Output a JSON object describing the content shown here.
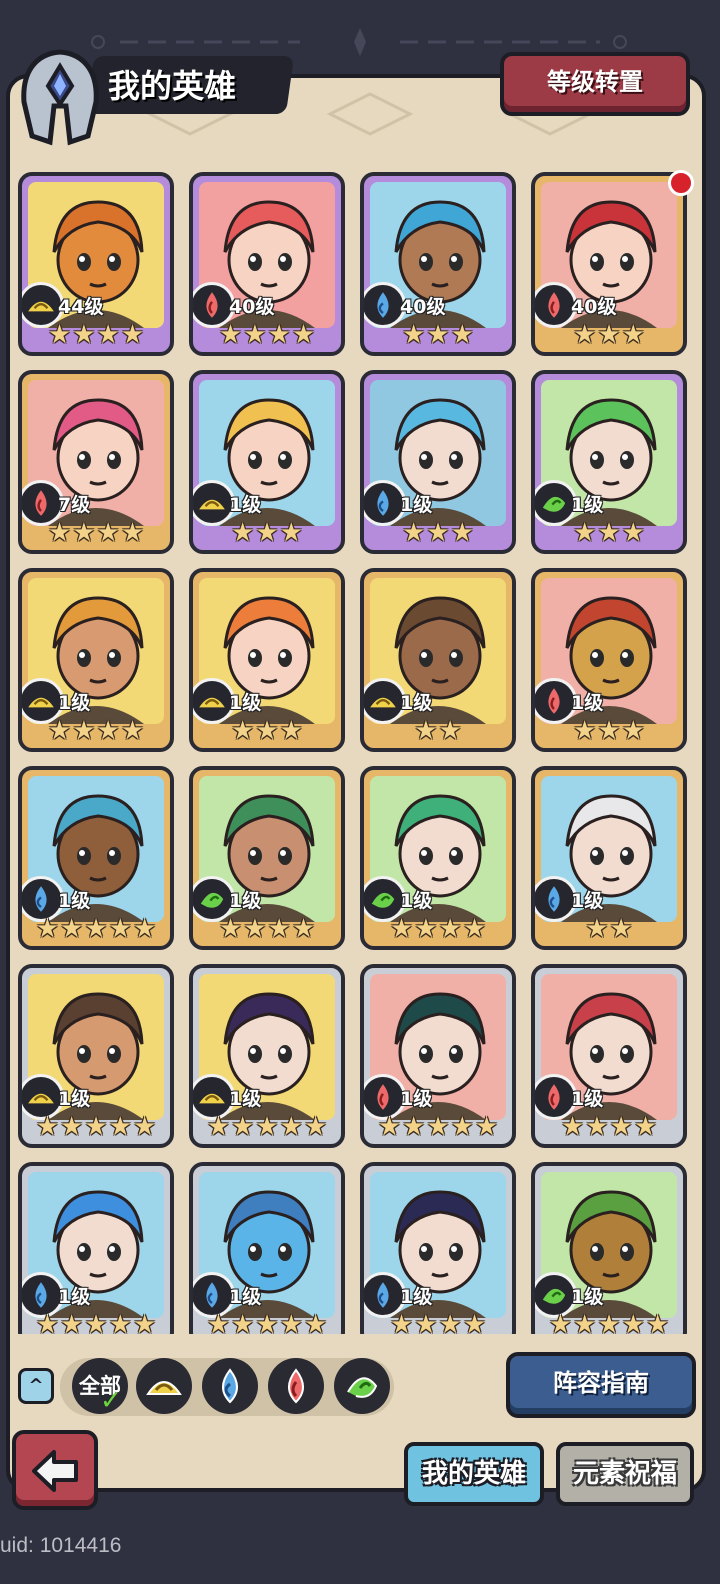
{
  "header": {
    "title": "我的英雄",
    "rank_button": "等级转置"
  },
  "heroes": [
    {
      "level": "44级",
      "stars": 4,
      "element": "earth",
      "frame": "purple",
      "skin": "#e38b3d",
      "hair": "#d9722a",
      "bg": "#f2d976"
    },
    {
      "level": "40级",
      "stars": 4,
      "element": "fire",
      "frame": "purple",
      "skin": "#f6d3c2",
      "hair": "#e65c5c",
      "bg": "#f3a0a0"
    },
    {
      "level": "40级",
      "stars": 3,
      "element": "water",
      "frame": "purple",
      "skin": "#b07a55",
      "hair": "#3fa6d6",
      "bg": "#9dd6ea"
    },
    {
      "level": "40级",
      "stars": 3,
      "element": "fire",
      "frame": "gold",
      "skin": "#f6d3c2",
      "hair": "#c8343a",
      "bg": "#f0b0a8"
    },
    {
      "level": "7级",
      "stars": 4,
      "element": "fire",
      "frame": "gold",
      "skin": "#f6d3c2",
      "hair": "#e25b86",
      "bg": "#f0b0a8"
    },
    {
      "level": "1级",
      "stars": 3,
      "element": "earth",
      "frame": "purple",
      "skin": "#f6d3c2",
      "hair": "#f0c050",
      "bg": "#9dd6ea"
    },
    {
      "level": "1级",
      "stars": 3,
      "element": "water",
      "frame": "purple",
      "skin": "#f2dcd0",
      "hair": "#58b8e0",
      "bg": "#8fc8e0"
    },
    {
      "level": "1级",
      "stars": 3,
      "element": "wind",
      "frame": "purple",
      "skin": "#f2dcd0",
      "hair": "#5cc35c",
      "bg": "#c2e6a8"
    },
    {
      "level": "1级",
      "stars": 4,
      "element": "earth",
      "frame": "gold",
      "skin": "#d89a70",
      "hair": "#e29a3a",
      "bg": "#f2d976"
    },
    {
      "level": "1级",
      "stars": 3,
      "element": "earth",
      "frame": "gold",
      "skin": "#f6d3c2",
      "hair": "#ec7d3a",
      "bg": "#f2d976"
    },
    {
      "level": "1级",
      "stars": 2,
      "element": "earth",
      "frame": "gold",
      "skin": "#9a6a4a",
      "hair": "#6b4a32",
      "bg": "#f2d976"
    },
    {
      "level": "1级",
      "stars": 3,
      "element": "fire",
      "frame": "gold",
      "skin": "#d4a24a",
      "hair": "#c2452f",
      "bg": "#f0b0a8"
    },
    {
      "level": "1级",
      "stars": 5,
      "element": "water",
      "frame": "gold",
      "skin": "#8e5f3a",
      "hair": "#4aa8c8",
      "bg": "#9dd6ea"
    },
    {
      "level": "1级",
      "stars": 4,
      "element": "wind",
      "frame": "gold",
      "skin": "#c89070",
      "hair": "#3f8f5a",
      "bg": "#c2e6a8"
    },
    {
      "level": "1级",
      "stars": 4,
      "element": "wind",
      "frame": "gold",
      "skin": "#f2dcd0",
      "hair": "#3fb07a",
      "bg": "#c2e6a8"
    },
    {
      "level": "1级",
      "stars": 2,
      "element": "water",
      "frame": "gold",
      "skin": "#f2dcd0",
      "hair": "#e8e8ea",
      "bg": "#9dd6ea"
    },
    {
      "level": "1级",
      "stars": 5,
      "element": "earth",
      "frame": "silver",
      "skin": "#d69a70",
      "hair": "#5a4030",
      "bg": "#f2d976"
    },
    {
      "level": "1级",
      "stars": 5,
      "element": "earth",
      "frame": "silver",
      "skin": "#f2dcd0",
      "hair": "#3a2a5a",
      "bg": "#f2d976"
    },
    {
      "level": "1级",
      "stars": 5,
      "element": "fire",
      "frame": "silver",
      "skin": "#f2dcd0",
      "hair": "#1f4a4a",
      "bg": "#f0b0a8"
    },
    {
      "level": "1级",
      "stars": 4,
      "element": "fire",
      "frame": "silver",
      "skin": "#f2dcd0",
      "hair": "#c8404a",
      "bg": "#f0b0a8"
    },
    {
      "level": "1级",
      "stars": 5,
      "element": "water",
      "frame": "silver",
      "skin": "#f2dcd0",
      "hair": "#3f8fdf",
      "bg": "#9dd6ea"
    },
    {
      "level": "1级",
      "stars": 5,
      "element": "water",
      "frame": "silver",
      "skin": "#5ab4e8",
      "hair": "#3f7fbf",
      "bg": "#9dd6ea"
    },
    {
      "level": "1级",
      "stars": 4,
      "element": "water",
      "frame": "silver",
      "skin": "#f2dcd0",
      "hair": "#2a2a55",
      "bg": "#9dd6ea"
    },
    {
      "level": "1级",
      "stars": 5,
      "element": "wind",
      "frame": "silver",
      "skin": "#b0803a",
      "hair": "#5aa040",
      "bg": "#c2e6a8"
    }
  ],
  "filters": {
    "all_label": "全部",
    "elements": [
      "earth",
      "water",
      "fire",
      "wind"
    ]
  },
  "formation_guide": "阵容指南",
  "tabs": {
    "my_heroes": "我的英雄",
    "blessing": "元素祝福"
  },
  "uid": "uid: 1014416",
  "element_colors": {
    "earth": "#f0d24a",
    "water": "#5aa8e6",
    "fire": "#ee6a6a",
    "wind": "#6ad04a"
  },
  "icons": [
    "helmet-icon",
    "back-arrow-icon",
    "earth-element-icon",
    "water-element-icon",
    "fire-element-icon",
    "wind-element-icon"
  ]
}
